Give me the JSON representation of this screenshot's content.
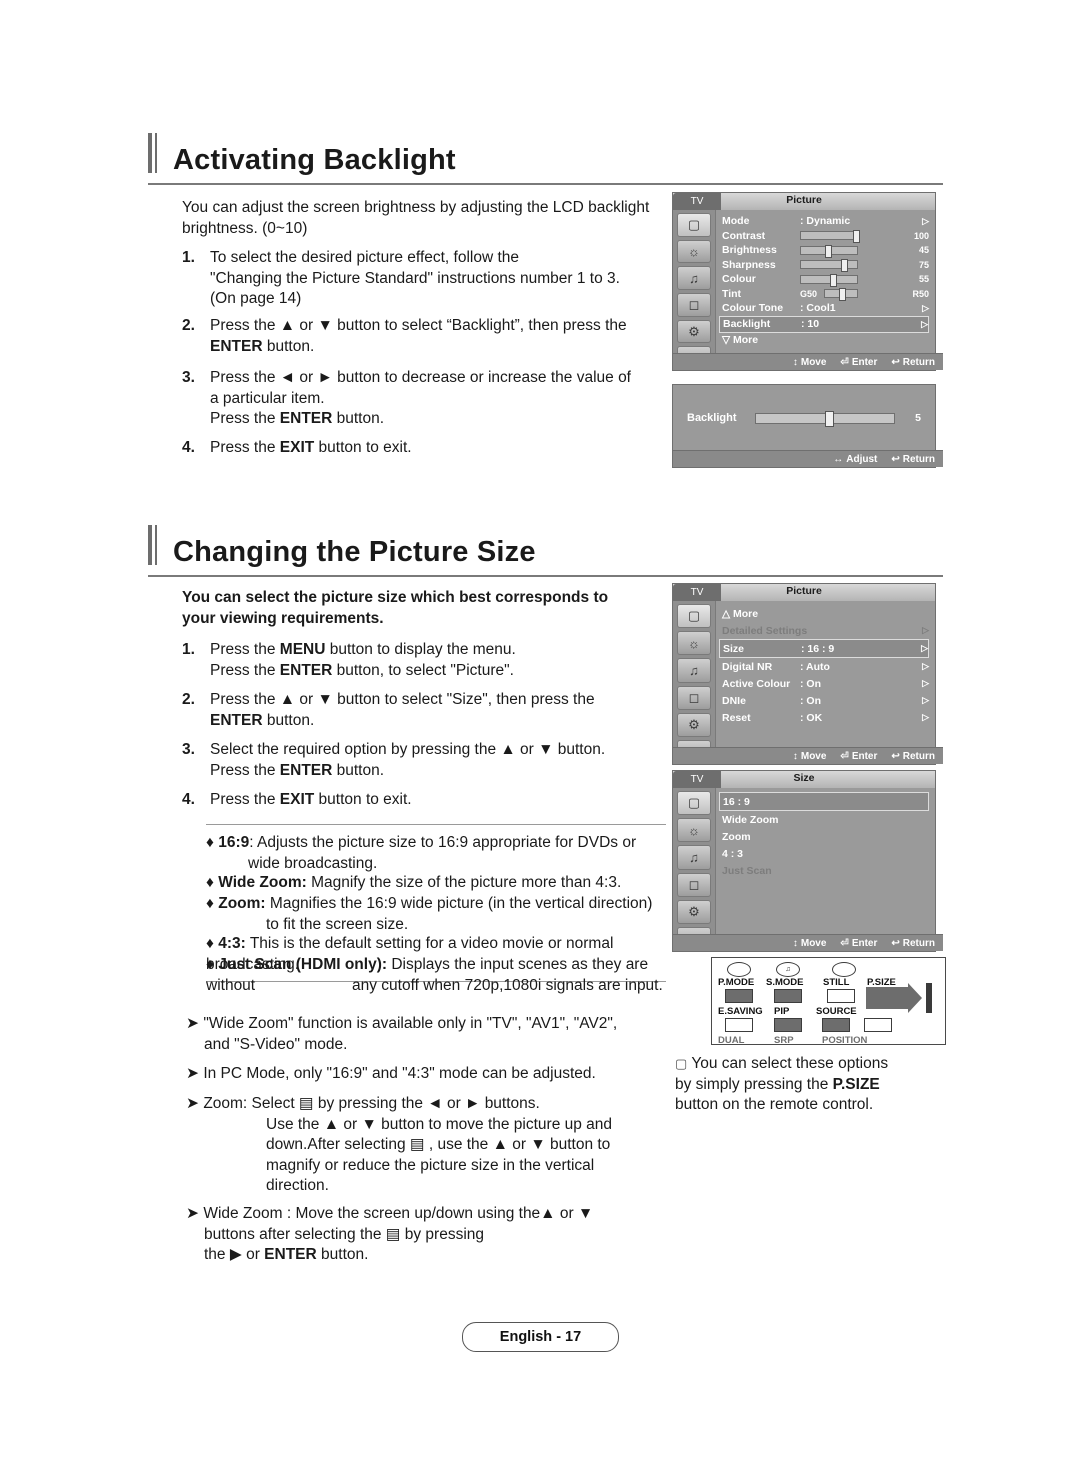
{
  "sections": [
    {
      "title": "Activating Backlight",
      "intro": "You can adjust the screen brightness by adjusting the LCD backlight brightness. (0~10)",
      "steps": [
        {
          "n": "1.",
          "lines": [
            "To select the desired picture effect, follow the",
            "\"Changing the Picture Standard\" instructions number 1 to 3.",
            "(On page 14)"
          ]
        },
        {
          "n": "2.",
          "lines": [
            "Press the ▲ or ▼ button to select “Backlight”, then press the",
            "ENTER button."
          ]
        },
        {
          "n": "3.",
          "lines": [
            "Press the ◄ or ► button to decrease or increase the value of",
            "a particular item.",
            "Press the ENTER button."
          ]
        },
        {
          "n": "4.",
          "lines": [
            "Press the EXIT button to exit."
          ]
        }
      ]
    },
    {
      "title": "Changing the Picture Size",
      "intro_lines": [
        "You can select the picture size which best corresponds to",
        "your viewing requirements."
      ],
      "steps": [
        {
          "n": "1.",
          "lines": [
            "Press the MENU button to display the menu.",
            "Press the ENTER button, to select \"Picture\"."
          ]
        },
        {
          "n": "2.",
          "lines": [
            "Press the ▲ or ▼ button to select \"Size\", then press the",
            "ENTER button."
          ]
        },
        {
          "n": "3.",
          "lines": [
            "Select the required option by pressing the ▲ or ▼ button.",
            "Press the ENTER button."
          ]
        },
        {
          "n": "4.",
          "lines": [
            "Press the EXIT button to exit."
          ]
        }
      ],
      "options": [
        {
          "bullet": "♦",
          "term": "16:9",
          "rest": "Adjusts the picture size to 16:9 appropriate for DVDs or",
          "cont": "wide broadcasting."
        },
        {
          "bullet": "♦",
          "term": "Wide Zoom:",
          "rest": "Magnify the size of the picture more than 4:3.",
          "cont": ""
        },
        {
          "bullet": "♦",
          "term": "Zoom:",
          "rest": "Magnifies the 16:9 wide picture (in the vertical direction)",
          "cont": "to fit the screen size."
        },
        {
          "bullet": "♦",
          "term": "4:3:",
          "rest": "This is the default setting for a video movie or normal broadcasting.",
          "cont": ""
        },
        {
          "bullet": "♦",
          "term": "Just Scan (HDMI only):",
          "rest": "Displays the input scenes as they are without",
          "cont": "any cutoff when 720p,1080i signals are input."
        }
      ],
      "notes": [
        {
          "lines": [
            "\"Wide Zoom\" function is available only in \"TV\", \"AV1\", \"AV2\",",
            "and \"S-Video\" mode."
          ]
        },
        {
          "lines": [
            "In PC Mode, only \"16:9\" and \"4:3\" mode can be adjusted."
          ]
        },
        {
          "lines": [
            "Zoom: Select ▤ by pressing the ◄ or ► buttons.",
            "Use the ▲ or ▼ button to move the picture up and",
            "down.After selecting ▤ , use the ▲ or ▼ button to",
            "magnify or reduce the picture size in the vertical",
            "direction."
          ]
        },
        {
          "lines": [
            "Wide Zoom : Move the screen up/down using the▲ or ▼",
            "buttons after selecting the ▤ by pressing",
            "the ► or ENTER button."
          ]
        }
      ]
    }
  ],
  "osd_picture1": {
    "tv_tag": "TV",
    "tab_title": "Picture",
    "rows": [
      {
        "label": "Mode",
        "value": ": Dynamic",
        "arrow": "▷",
        "type": "text"
      },
      {
        "label": "Contrast",
        "value": "",
        "num": "100",
        "type": "bar",
        "fill": 0.97
      },
      {
        "label": "Brightness",
        "value": "",
        "num": "45",
        "type": "bar",
        "fill": 0.45
      },
      {
        "label": "Sharpness",
        "value": "",
        "num": "75",
        "type": "bar",
        "fill": 0.75
      },
      {
        "label": "Colour",
        "value": "",
        "num": "55",
        "type": "bar",
        "fill": 0.55
      },
      {
        "label": "Tint",
        "value": "",
        "num": "",
        "type": "tint",
        "left": "G50",
        "right": "R50"
      },
      {
        "label": "Colour Tone",
        "value": ": Cool1",
        "arrow": "▷",
        "type": "text"
      },
      {
        "label": "Backlight",
        "value": ": 10",
        "arrow": "▷",
        "type": "text",
        "highlight": true
      },
      {
        "label": "▽ More",
        "value": "",
        "arrow": "",
        "type": "text"
      }
    ],
    "footer": [
      {
        "icon": "↕",
        "label": "Move"
      },
      {
        "icon": "⏎",
        "label": "Enter"
      },
      {
        "icon": "↩",
        "label": "Return"
      }
    ]
  },
  "osd_backlight_slider": {
    "label": "Backlight",
    "value": "5",
    "footer": [
      {
        "icon": "↔",
        "label": "Adjust"
      },
      {
        "icon": "↩",
        "label": "Return"
      }
    ]
  },
  "osd_picture2": {
    "tv_tag": "TV",
    "tab_title": "Picture",
    "rows": [
      {
        "label": "△ More",
        "value": "",
        "arrow": "",
        "type": "text"
      },
      {
        "label": "Detailed Settings",
        "value": "",
        "arrow": "▷",
        "type": "text",
        "dim": true
      },
      {
        "label": "Size",
        "value": ": 16 : 9",
        "arrow": "▷",
        "type": "text",
        "highlight": true
      },
      {
        "label": "Digital NR",
        "value": ": Auto",
        "arrow": "▷",
        "type": "text"
      },
      {
        "label": "Active Colour",
        "value": ": On",
        "arrow": "▷",
        "type": "text"
      },
      {
        "label": "DNIe",
        "value": ": On",
        "arrow": "▷",
        "type": "text"
      },
      {
        "label": "Reset",
        "value": ": OK",
        "arrow": "▷",
        "type": "text"
      }
    ],
    "footer": [
      {
        "icon": "↕",
        "label": "Move"
      },
      {
        "icon": "⏎",
        "label": "Enter"
      },
      {
        "icon": "↩",
        "label": "Return"
      }
    ]
  },
  "osd_size": {
    "tv_tag": "TV",
    "tab_title": "Size",
    "rows": [
      {
        "label": "16 : 9",
        "highlight": true
      },
      {
        "label": "Wide Zoom"
      },
      {
        "label": "Zoom"
      },
      {
        "label": "4 : 3"
      },
      {
        "label": "Just Scan",
        "dim": true
      }
    ],
    "footer": [
      {
        "icon": "↕",
        "label": "Move"
      },
      {
        "icon": "⏎",
        "label": "Enter"
      },
      {
        "icon": "↩",
        "label": "Return"
      }
    ]
  },
  "remote": {
    "labels_row1": [
      "P.MODE",
      "S.MODE",
      "STILL",
      "P.SIZE"
    ],
    "labels_row2": [
      "E.SAVING",
      "PIP",
      "SOURCE"
    ],
    "labels_row3": [
      "DUAL",
      "SRP",
      "POSITION"
    ]
  },
  "remote_note": {
    "lines": [
      "You can select these options",
      "by simply pressing the P.SIZE",
      "button on the remote control."
    ],
    "bold_part": "P.SIZE"
  },
  "footer": {
    "page_label": "English - 17"
  }
}
